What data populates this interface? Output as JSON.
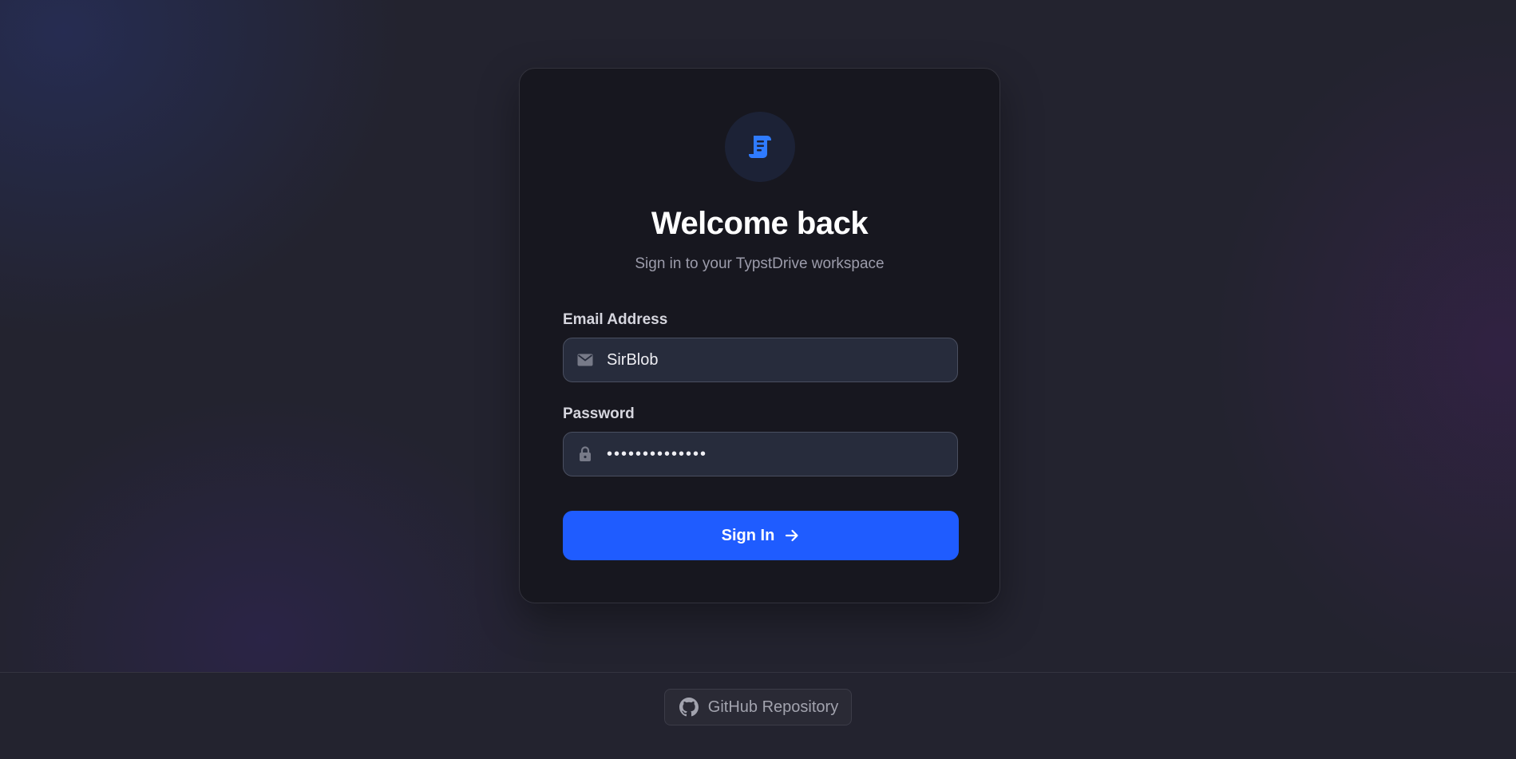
{
  "login": {
    "title": "Welcome back",
    "subtitle": "Sign in to your TypstDrive workspace",
    "email": {
      "label": "Email Address",
      "value": "SirBlob",
      "icon": "mail-icon"
    },
    "password": {
      "label": "Password",
      "value": "••••••••••••••",
      "icon": "lock-icon"
    },
    "submit": {
      "label": "Sign In",
      "icon": "arrow-right-icon"
    },
    "logo_icon": "scroll-icon"
  },
  "footer": {
    "github_label": "GitHub Repository",
    "github_icon": "github-icon"
  },
  "colors": {
    "accent": "#1f5cff",
    "card_bg": "#17171f",
    "page_bg": "#23232f",
    "input_bg": "#272c3c"
  }
}
